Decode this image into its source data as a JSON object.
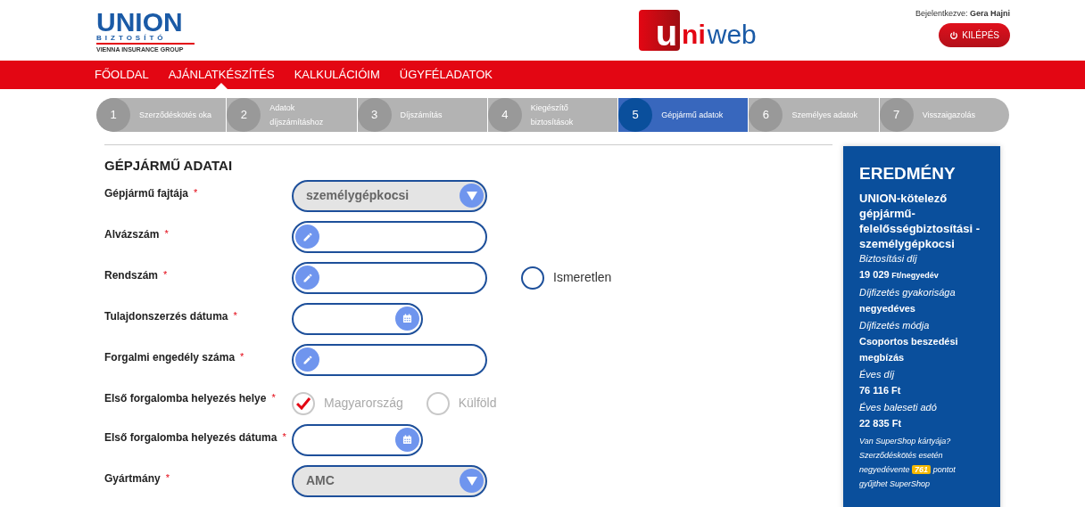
{
  "header": {
    "logo": {
      "brand": "UNION",
      "sub": "BIZTOSÍTÓ",
      "group": "VIENNA INSURANCE GROUP"
    },
    "app_logo": {
      "mark": "u",
      "part1": "ni",
      "part2": "web"
    },
    "login_label": "Bejelentkezve:",
    "user": "Gera Hajni",
    "logout": "KILÉPÉS"
  },
  "nav": [
    {
      "label": "FŐOLDAL",
      "selected": false
    },
    {
      "label": "AJÁNLATKÉSZÍTÉS",
      "selected": true
    },
    {
      "label": "KALKULÁCIÓIM",
      "selected": false
    },
    {
      "label": "ÜGYFÉLADATOK",
      "selected": false
    }
  ],
  "steps": [
    {
      "number": "1",
      "label": "Szerződéskötés oka",
      "selected": false
    },
    {
      "number": "2",
      "label": "Adatok díjszámításhoz",
      "selected": false
    },
    {
      "number": "3",
      "label": "Díjszámítás",
      "selected": false
    },
    {
      "number": "4",
      "label": "Kiegészítő biztosítások",
      "selected": false
    },
    {
      "number": "5",
      "label": "Gépjármű adatok",
      "selected": true
    },
    {
      "number": "6",
      "label": "Személyes adatok",
      "selected": false
    },
    {
      "number": "7",
      "label": "Visszaigazolás",
      "selected": false
    }
  ],
  "form": {
    "title": "GÉPJÁRMŰ ADATAI",
    "required_mark": "*",
    "fields": [
      {
        "label": "Gépjármű fajtája",
        "kind": "select",
        "value": "személygépkocsi"
      },
      {
        "label": "Alvázszám",
        "kind": "text"
      },
      {
        "label": "Rendszám",
        "kind": "text",
        "extra": {
          "label": "Ismeretlen",
          "checked": false
        }
      },
      {
        "label": "Tulajdonszerzés dátuma",
        "kind": "date"
      },
      {
        "label": "Forgalmi engedély száma",
        "kind": "text"
      },
      {
        "label": "Első forgalomba helyezés helye",
        "kind": "radio",
        "options": [
          {
            "label": "Magyarország",
            "selected": true
          },
          {
            "label": "Külföld",
            "selected": false
          }
        ]
      },
      {
        "label": "Első forgalomba helyezés dátuma",
        "kind": "date"
      },
      {
        "label": "Gyártmány",
        "kind": "select",
        "value": "AMC"
      }
    ]
  },
  "result": {
    "title": "EREDMÉNY",
    "product": "UNION-kötelező gépjármű-felelősségbiztosítási - személygépkocsi",
    "items": [
      {
        "label": "Biztosítási díj",
        "value": "19 029",
        "unit": "Ft/negyedév"
      },
      {
        "label": "Díjfizetés gyakorisága",
        "value": "negyedéves"
      },
      {
        "label": "Díjfizetés módja",
        "value": "Csoportos beszedési megbízás"
      },
      {
        "label": "Éves díj",
        "value": "76 116 Ft"
      },
      {
        "label": "Éves baleseti adó",
        "value": "22 835 Ft"
      }
    ],
    "promo": {
      "line1": "Van SuperShop kártyája? Szerződéskötés esetén negyedévente",
      "points": "761",
      "line2": "pontot gyűjthet SuperShop"
    }
  }
}
